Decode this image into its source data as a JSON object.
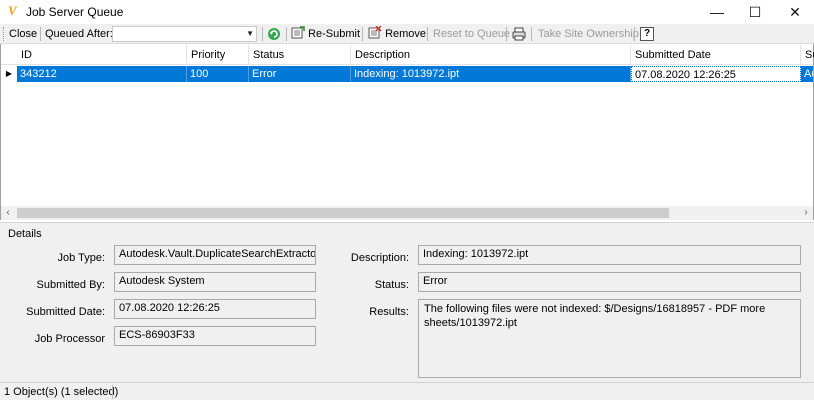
{
  "window": {
    "title": "Job Server Queue",
    "icon_glyph": "V",
    "controls": {
      "minimize": "—",
      "maximize": "☐",
      "close": "✕"
    }
  },
  "toolbar": {
    "close_label": "Close",
    "queued_after_label": "Queued After:",
    "queued_after_value": "",
    "resubmit_label": "Re-Submit",
    "remove_label": "Remove",
    "reset_label": "Reset to Queue",
    "take_ownership_label": "Take Site Ownership",
    "help_label": "?"
  },
  "grid": {
    "columns": [
      "ID",
      "Priority",
      "Status",
      "Description",
      "Submitted Date",
      "Su"
    ],
    "rows": [
      {
        "id": "343212",
        "priority": "100",
        "status": "Error",
        "description": "Indexing: 1013972.ipt",
        "submitted_date": "07.08.2020 12:26:25",
        "su": "Au"
      }
    ]
  },
  "details": {
    "title": "Details",
    "job_type_label": "Job Type:",
    "job_type_value": "Autodesk.Vault.DuplicateSearchExtractor",
    "submitted_by_label": "Submitted By:",
    "submitted_by_value": "Autodesk System",
    "submitted_date_label": "Submitted Date:",
    "submitted_date_value": "07.08.2020 12:26:25",
    "job_processor_label": "Job Processor",
    "job_processor_value": "ECS-86903F33",
    "description_label": "Description:",
    "description_value": "Indexing: 1013972.ipt",
    "status_label": "Status:",
    "status_value": "Error",
    "results_label": "Results:",
    "results_value": "The following files were not indexed:    $/Designs/16818957 - PDF more sheets/1013972.ipt"
  },
  "statusbar": {
    "text": "1 Object(s) (1 selected)"
  },
  "colors": {
    "selection": "#0078d7",
    "app_icon": "#e8a400",
    "disabled_text": "#9b9b9b"
  }
}
